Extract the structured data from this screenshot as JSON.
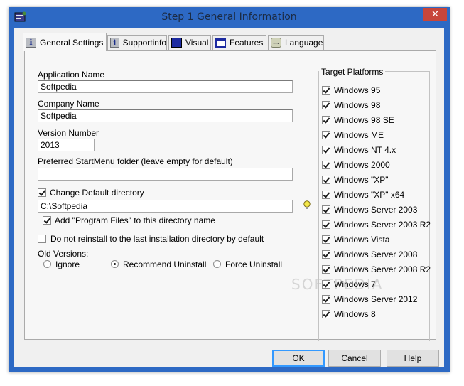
{
  "window": {
    "title": "Step 1 General Information",
    "close_symbol": "✕",
    "accent_color": "#2d69c4",
    "close_color": "#c7463b",
    "app_icon": "installer-app-icon"
  },
  "tabs": [
    {
      "label": "General Settings",
      "icon": "info-icon",
      "active": true
    },
    {
      "label": "Supportinfo",
      "icon": "info-icon",
      "active": false
    },
    {
      "label": "Visual",
      "icon": "visual-icon",
      "active": false
    },
    {
      "label": "Features",
      "icon": "features-window-icon",
      "active": false
    },
    {
      "label": "Language",
      "icon": "language-bubble-icon",
      "active": false
    }
  ],
  "tab_icon_text": {
    "info": "i"
  },
  "form": {
    "app_name_label": "Application Name",
    "app_name_value": "Softpedia",
    "company_label": "Company Name",
    "company_value": "Softpedia",
    "version_label": "Version Number",
    "version_value": "2013",
    "startmenu_label": "Preferred StartMenu folder (leave empty for default)",
    "startmenu_value": "",
    "change_dir_label": "Change Default directory",
    "change_dir_checked": true,
    "dir_value": "C:\\Softpedia",
    "add_program_files_label": "Add \"Program Files\" to this directory name",
    "add_program_files_checked": true,
    "no_reinstall_label": "Do not reinstall to the last installation directory by default",
    "no_reinstall_checked": false,
    "old_versions_label": "Old Versions:",
    "old_versions_options": [
      "Ignore",
      "Recommend Uninstall",
      "Force Uninstall"
    ],
    "old_versions_selected": "Recommend Uninstall"
  },
  "platforms": {
    "title": "Target Platforms",
    "items": [
      {
        "label": "Windows 95",
        "checked": true
      },
      {
        "label": "Windows 98",
        "checked": true
      },
      {
        "label": "Windows 98 SE",
        "checked": true
      },
      {
        "label": "Windows ME",
        "checked": true
      },
      {
        "label": "Windows NT 4.x",
        "checked": true
      },
      {
        "label": "Windows 2000",
        "checked": true
      },
      {
        "label": "Windows \"XP\"",
        "checked": true
      },
      {
        "label": "Windows \"XP\" x64",
        "checked": true
      },
      {
        "label": "Windows Server 2003",
        "checked": true
      },
      {
        "label": "Windows Server 2003 R2",
        "checked": true
      },
      {
        "label": "Windows Vista",
        "checked": true
      },
      {
        "label": "Windows Server 2008",
        "checked": true
      },
      {
        "label": "Windows Server 2008 R2",
        "checked": true
      },
      {
        "label": "Windows 7",
        "checked": true
      },
      {
        "label": "Windows Server 2012",
        "checked": true
      },
      {
        "label": "Windows 8",
        "checked": true
      }
    ]
  },
  "buttons": {
    "ok": "OK",
    "cancel": "Cancel",
    "help": "Help"
  },
  "watermark": "SOFTPEDIA"
}
